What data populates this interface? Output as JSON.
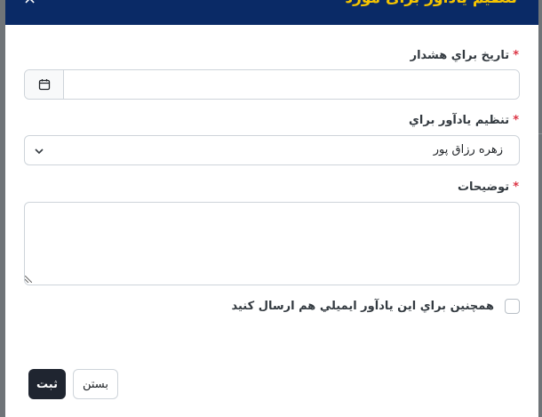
{
  "dialog": {
    "title": "تنظیم یادآور برای مورد",
    "close_glyph": "×"
  },
  "form": {
    "date_label": "تاريخ براي هشدار",
    "date_value": "",
    "date_icon": "calendar-icon",
    "reminder_for_label": "تنظيم يادآور براي",
    "reminder_for_value": "زهره رزاق پور",
    "description_label": "توضيحات",
    "description_value": "",
    "required_mark": "*",
    "email_checkbox_label": "همچنين براي اين يادآور ايميلي هم ارسال كنيد",
    "email_checkbox_checked": false
  },
  "footer": {
    "submit_label": "ثبت",
    "close_label": "بستن"
  },
  "colors": {
    "header_bg": "#0a2a66",
    "title_color": "#f5c400",
    "required_color": "#dc3545",
    "submit_bg": "#1f2530"
  }
}
